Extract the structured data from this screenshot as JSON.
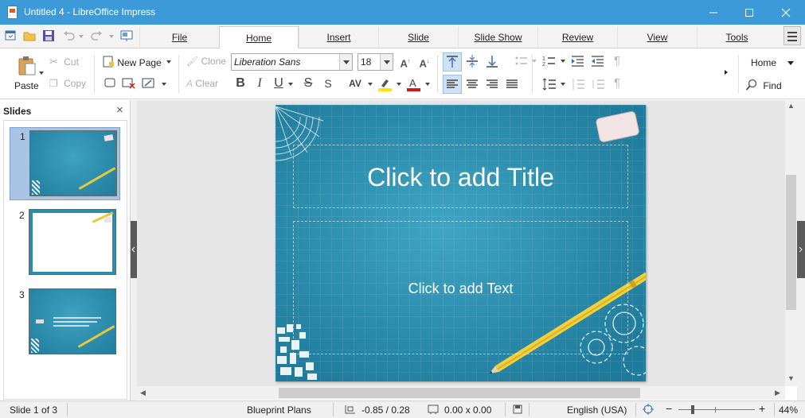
{
  "window": {
    "title": "Untitled 4 - LibreOffice Impress",
    "controls": {
      "minimize": "minimize-icon",
      "maximize": "maximize-icon",
      "close": "close-icon"
    }
  },
  "tabs": [
    {
      "label": "File",
      "active": false
    },
    {
      "label": "Home",
      "active": true
    },
    {
      "label": "Insert",
      "active": false
    },
    {
      "label": "Slide",
      "active": false
    },
    {
      "label": "Slide Show",
      "active": false
    },
    {
      "label": "Review",
      "active": false
    },
    {
      "label": "View",
      "active": false
    },
    {
      "label": "Tools",
      "active": false
    }
  ],
  "ribbon": {
    "paste": "Paste",
    "cut": "Cut",
    "copy": "Copy",
    "new_page": "New Page",
    "clone": "Clone",
    "clear": "Clear",
    "font_name": "Liberation Sans",
    "font_size": "18",
    "home_menu": "Home",
    "find": "Find"
  },
  "slides_pane": {
    "title": "Slides",
    "slides": [
      {
        "number": "1",
        "selected": true
      },
      {
        "number": "2",
        "selected": false
      },
      {
        "number": "3",
        "selected": false
      }
    ]
  },
  "slide": {
    "title_placeholder": "Click to add Title",
    "text_placeholder": "Click to add Text",
    "background_color": "#2d8bab"
  },
  "statusbar": {
    "slide_info": "Slide 1 of 3",
    "master": "Blueprint Plans",
    "position": "-0.85 / 0.28",
    "size": "0.00 x 0.00",
    "language": "English (USA)",
    "zoom": "44%"
  },
  "colors": {
    "titlebar": "#3c9ad8",
    "selection": "#a9c4e3",
    "highlight_yellow": "#ffe600",
    "font_color_red": "#d01818"
  }
}
